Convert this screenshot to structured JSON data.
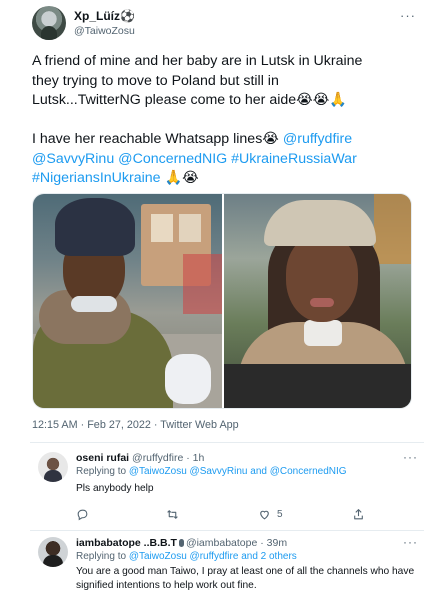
{
  "main_tweet": {
    "display_name": "Xp_Lüíz⚽",
    "handle": "@TaiwoZosu",
    "more_label": "···",
    "text_line1": "A friend of mine and her baby are in Lutsk in Ukraine",
    "text_line2": "they trying to move to Poland but still in",
    "text_line3": "Lutsk...TwitterNG please come to her aide😭😭🙏",
    "text_line4a": "I have her reachable Whatsapp lines😭 ",
    "mention_ruffy": "@ruffydfire",
    "mention_savvy": "@SavvyRinu",
    "mention_concerned": "@ConcernedNIG",
    "hashtag_war": "#UkraineRussiaWar",
    "hashtag_nigerians": "#NigeriansInUkraine",
    "text_end_emoji": " 🙏😭",
    "timestamp": "12:15 AM · Feb 27, 2022 · Twitter Web App"
  },
  "replies": [
    {
      "display_name": "oseni rufai",
      "handle_time": "@ruffydfire · 1h",
      "replying_prefix": "Replying to ",
      "replying_to": "@TaiwoZosu @SavvyRinu and @ConcernedNIG",
      "text": "Pls anybody help",
      "more_label": "···",
      "reply_count": "",
      "retweet_count": "",
      "like_count": "5"
    },
    {
      "display_name": "iambabatope ..B.B.T",
      "handle_time": "@iambabatope · 39m",
      "replying_prefix": "Replying to ",
      "replying_to": "@TaiwoZosu @ruffydfire and 2 others",
      "text_line1": "You are a good man Taiwo, I pray at least one of all the channels who have",
      "text_line2": "signified intentions to help work out fine.",
      "more_label": "···"
    }
  ],
  "icons": {
    "reply": "reply-icon",
    "retweet": "retweet-icon",
    "like": "like-icon",
    "share": "share-icon"
  },
  "colors": {
    "link": "#1d9bf0",
    "secondary_text": "#536471",
    "primary_text": "#0f1419"
  }
}
